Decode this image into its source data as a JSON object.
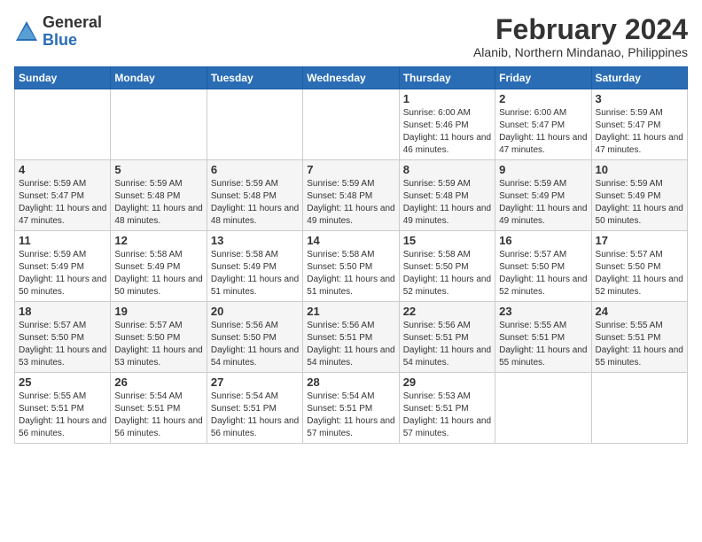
{
  "header": {
    "logo": {
      "general": "General",
      "blue": "Blue"
    },
    "title": "February 2024",
    "location": "Alanib, Northern Mindanao, Philippines"
  },
  "columns": [
    "Sunday",
    "Monday",
    "Tuesday",
    "Wednesday",
    "Thursday",
    "Friday",
    "Saturday"
  ],
  "weeks": [
    [
      {
        "day": "",
        "sunrise": "",
        "sunset": "",
        "daylight": ""
      },
      {
        "day": "",
        "sunrise": "",
        "sunset": "",
        "daylight": ""
      },
      {
        "day": "",
        "sunrise": "",
        "sunset": "",
        "daylight": ""
      },
      {
        "day": "",
        "sunrise": "",
        "sunset": "",
        "daylight": ""
      },
      {
        "day": "1",
        "sunrise": "Sunrise: 6:00 AM",
        "sunset": "Sunset: 5:46 PM",
        "daylight": "Daylight: 11 hours and 46 minutes."
      },
      {
        "day": "2",
        "sunrise": "Sunrise: 6:00 AM",
        "sunset": "Sunset: 5:47 PM",
        "daylight": "Daylight: 11 hours and 47 minutes."
      },
      {
        "day": "3",
        "sunrise": "Sunrise: 5:59 AM",
        "sunset": "Sunset: 5:47 PM",
        "daylight": "Daylight: 11 hours and 47 minutes."
      }
    ],
    [
      {
        "day": "4",
        "sunrise": "Sunrise: 5:59 AM",
        "sunset": "Sunset: 5:47 PM",
        "daylight": "Daylight: 11 hours and 47 minutes."
      },
      {
        "day": "5",
        "sunrise": "Sunrise: 5:59 AM",
        "sunset": "Sunset: 5:48 PM",
        "daylight": "Daylight: 11 hours and 48 minutes."
      },
      {
        "day": "6",
        "sunrise": "Sunrise: 5:59 AM",
        "sunset": "Sunset: 5:48 PM",
        "daylight": "Daylight: 11 hours and 48 minutes."
      },
      {
        "day": "7",
        "sunrise": "Sunrise: 5:59 AM",
        "sunset": "Sunset: 5:48 PM",
        "daylight": "Daylight: 11 hours and 49 minutes."
      },
      {
        "day": "8",
        "sunrise": "Sunrise: 5:59 AM",
        "sunset": "Sunset: 5:48 PM",
        "daylight": "Daylight: 11 hours and 49 minutes."
      },
      {
        "day": "9",
        "sunrise": "Sunrise: 5:59 AM",
        "sunset": "Sunset: 5:49 PM",
        "daylight": "Daylight: 11 hours and 49 minutes."
      },
      {
        "day": "10",
        "sunrise": "Sunrise: 5:59 AM",
        "sunset": "Sunset: 5:49 PM",
        "daylight": "Daylight: 11 hours and 50 minutes."
      }
    ],
    [
      {
        "day": "11",
        "sunrise": "Sunrise: 5:59 AM",
        "sunset": "Sunset: 5:49 PM",
        "daylight": "Daylight: 11 hours and 50 minutes."
      },
      {
        "day": "12",
        "sunrise": "Sunrise: 5:58 AM",
        "sunset": "Sunset: 5:49 PM",
        "daylight": "Daylight: 11 hours and 50 minutes."
      },
      {
        "day": "13",
        "sunrise": "Sunrise: 5:58 AM",
        "sunset": "Sunset: 5:49 PM",
        "daylight": "Daylight: 11 hours and 51 minutes."
      },
      {
        "day": "14",
        "sunrise": "Sunrise: 5:58 AM",
        "sunset": "Sunset: 5:50 PM",
        "daylight": "Daylight: 11 hours and 51 minutes."
      },
      {
        "day": "15",
        "sunrise": "Sunrise: 5:58 AM",
        "sunset": "Sunset: 5:50 PM",
        "daylight": "Daylight: 11 hours and 52 minutes."
      },
      {
        "day": "16",
        "sunrise": "Sunrise: 5:57 AM",
        "sunset": "Sunset: 5:50 PM",
        "daylight": "Daylight: 11 hours and 52 minutes."
      },
      {
        "day": "17",
        "sunrise": "Sunrise: 5:57 AM",
        "sunset": "Sunset: 5:50 PM",
        "daylight": "Daylight: 11 hours and 52 minutes."
      }
    ],
    [
      {
        "day": "18",
        "sunrise": "Sunrise: 5:57 AM",
        "sunset": "Sunset: 5:50 PM",
        "daylight": "Daylight: 11 hours and 53 minutes."
      },
      {
        "day": "19",
        "sunrise": "Sunrise: 5:57 AM",
        "sunset": "Sunset: 5:50 PM",
        "daylight": "Daylight: 11 hours and 53 minutes."
      },
      {
        "day": "20",
        "sunrise": "Sunrise: 5:56 AM",
        "sunset": "Sunset: 5:50 PM",
        "daylight": "Daylight: 11 hours and 54 minutes."
      },
      {
        "day": "21",
        "sunrise": "Sunrise: 5:56 AM",
        "sunset": "Sunset: 5:51 PM",
        "daylight": "Daylight: 11 hours and 54 minutes."
      },
      {
        "day": "22",
        "sunrise": "Sunrise: 5:56 AM",
        "sunset": "Sunset: 5:51 PM",
        "daylight": "Daylight: 11 hours and 54 minutes."
      },
      {
        "day": "23",
        "sunrise": "Sunrise: 5:55 AM",
        "sunset": "Sunset: 5:51 PM",
        "daylight": "Daylight: 11 hours and 55 minutes."
      },
      {
        "day": "24",
        "sunrise": "Sunrise: 5:55 AM",
        "sunset": "Sunset: 5:51 PM",
        "daylight": "Daylight: 11 hours and 55 minutes."
      }
    ],
    [
      {
        "day": "25",
        "sunrise": "Sunrise: 5:55 AM",
        "sunset": "Sunset: 5:51 PM",
        "daylight": "Daylight: 11 hours and 56 minutes."
      },
      {
        "day": "26",
        "sunrise": "Sunrise: 5:54 AM",
        "sunset": "Sunset: 5:51 PM",
        "daylight": "Daylight: 11 hours and 56 minutes."
      },
      {
        "day": "27",
        "sunrise": "Sunrise: 5:54 AM",
        "sunset": "Sunset: 5:51 PM",
        "daylight": "Daylight: 11 hours and 56 minutes."
      },
      {
        "day": "28",
        "sunrise": "Sunrise: 5:54 AM",
        "sunset": "Sunset: 5:51 PM",
        "daylight": "Daylight: 11 hours and 57 minutes."
      },
      {
        "day": "29",
        "sunrise": "Sunrise: 5:53 AM",
        "sunset": "Sunset: 5:51 PM",
        "daylight": "Daylight: 11 hours and 57 minutes."
      },
      {
        "day": "",
        "sunrise": "",
        "sunset": "",
        "daylight": ""
      },
      {
        "day": "",
        "sunrise": "",
        "sunset": "",
        "daylight": ""
      }
    ]
  ]
}
